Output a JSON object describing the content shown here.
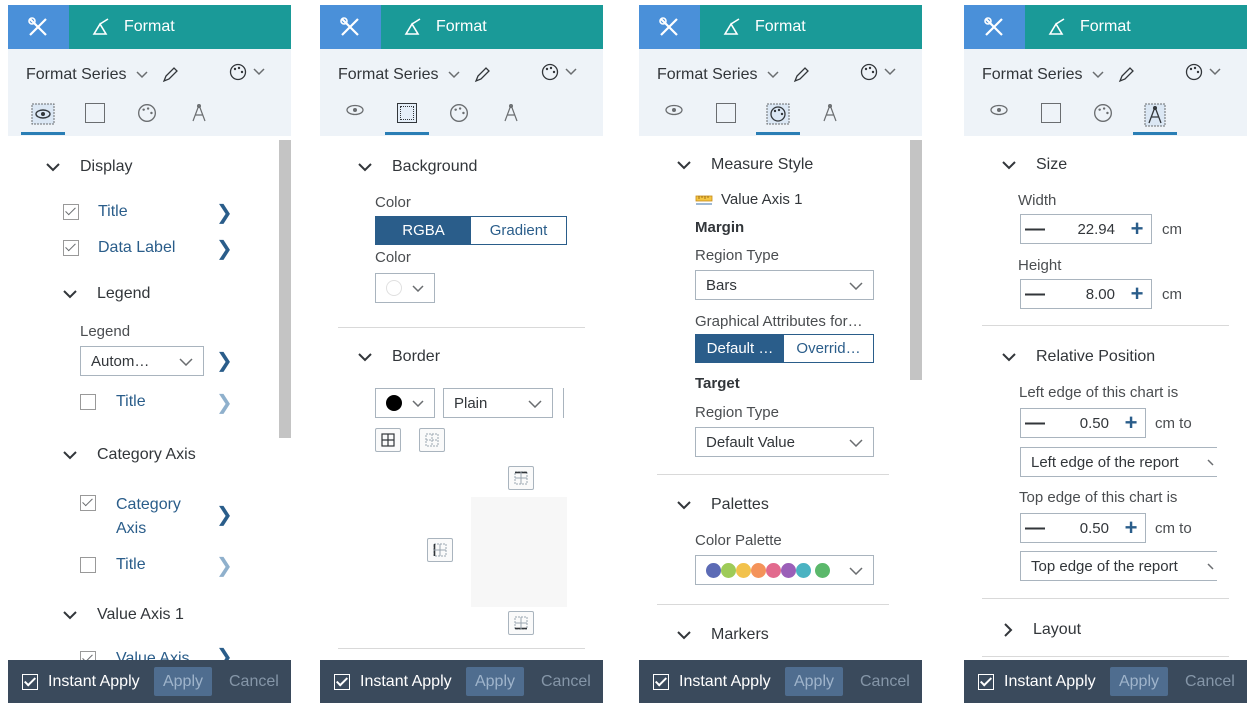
{
  "common": {
    "format_label": "Format",
    "format_series": "Format Series",
    "instant_apply": "Instant Apply",
    "apply": "Apply",
    "cancel": "Cancel"
  },
  "panel1": {
    "display": "Display",
    "title": "Title",
    "data_label": "Data Label",
    "legend_section": "Legend",
    "legend_label": "Legend",
    "legend_value": "Autom…",
    "legend_title": "Title",
    "category_axis_section": "Category Axis",
    "category_axis_line1": "Category",
    "category_axis_line2": "Axis",
    "ca_title": "Title",
    "value_axis_section": "Value Axis 1",
    "value_axis_item": "Value Axis"
  },
  "panel2": {
    "background": "Background",
    "color_label1": "Color",
    "seg_rgba": "RGBA",
    "seg_gradient": "Gradient",
    "color_label2": "Color",
    "border": "Border",
    "border_style": "Plain"
  },
  "panel3": {
    "measure_style": "Measure Style",
    "value_axis": "Value Axis 1",
    "margin": "Margin",
    "region_type1": "Region Type",
    "region_value1": "Bars",
    "graphical_attr": "Graphical Attributes for…",
    "seg_default": "Default …",
    "seg_override": "Overrid…",
    "target": "Target",
    "region_type2": "Region Type",
    "region_value2": "Default Value",
    "palettes": "Palettes",
    "color_palette": "Color Palette",
    "palette_colors": [
      "#5c6bb5",
      "#9ecb58",
      "#f2c24c",
      "#f4935a",
      "#e26a8e",
      "#9b5fb8",
      "#4bb3c2",
      "#5bb86b"
    ],
    "markers": "Markers"
  },
  "panel4": {
    "size": "Size",
    "width_label": "Width",
    "width_value": "22.94",
    "width_unit": "cm",
    "height_label": "Height",
    "height_value": "8.00",
    "height_unit": "cm",
    "relative_position": "Relative Position",
    "left_edge_label": "Left edge of this chart is",
    "left_value": "0.50",
    "left_unit": "cm to",
    "left_select": "Left edge of the report",
    "top_edge_label": "Top edge of this chart is",
    "top_value": "0.50",
    "top_unit": "cm to",
    "top_select": "Top edge of the report",
    "layout": "Layout"
  }
}
